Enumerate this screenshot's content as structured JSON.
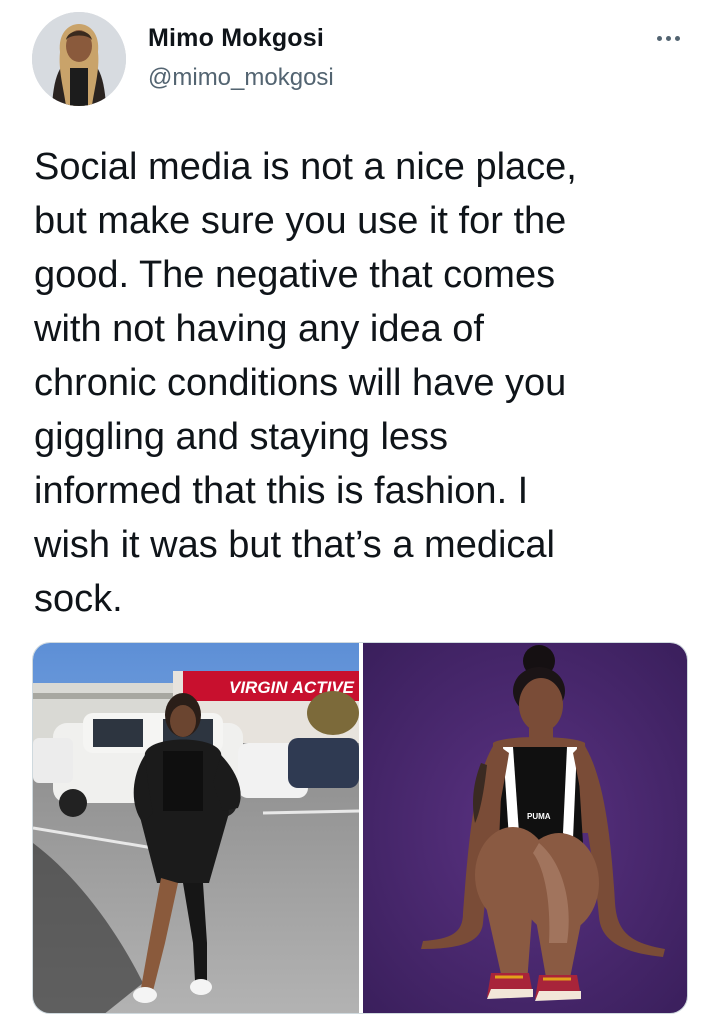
{
  "author": {
    "name": "Mimo Mokgosi",
    "handle": "@mimo_mokgosi"
  },
  "more_icon": "more-horizontal-icon",
  "tweet": {
    "text": "Social media is not a nice place,\nbut make sure you use it for the\ngood. The negative that comes\nwith not having any idea of\nchronic conditions will have you\ngiggling and staying less\ninformed that this is fashion. I\nwish it was but that’s a medical\nsock."
  },
  "media": {
    "left_photo": {
      "sign_text": "VIRGIN ACTIVE H"
    },
    "right_photo": {
      "top_logo": "PUMA",
      "shoe_logo": "PUMA"
    }
  },
  "colors": {
    "text_primary": "#0f1419",
    "text_secondary": "#536471",
    "border": "#cfd9de",
    "purple_backdrop": "#4b2a6e",
    "sign_red": "#c8102e"
  }
}
